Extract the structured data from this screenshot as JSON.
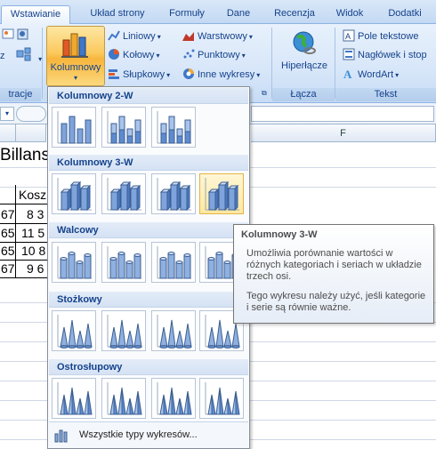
{
  "tabs": [
    {
      "label": "Wstawianie",
      "active": true
    },
    {
      "label": "Układ strony"
    },
    {
      "label": "Formuły"
    },
    {
      "label": "Dane"
    },
    {
      "label": "Recenzja"
    },
    {
      "label": "Widok"
    },
    {
      "label": "Dodatki"
    }
  ],
  "ribbon": {
    "left_group_label": "tracje",
    "left_small_label": "z",
    "columns_button": "Kolumnowy",
    "charts_small": {
      "liniowy": "Liniowy",
      "kolowy": "Kołowy",
      "slupkowy": "Słupkowy",
      "warstwowy": "Warstwowy",
      "punktowy": "Punktowy",
      "inne": "Inne wykresy"
    },
    "hyperlink": "Hiperłącze",
    "links_group": "Łącza",
    "text": {
      "pole": "Pole tekstowe",
      "naglowek": "Nagłówek i stop",
      "wordart": "WordArt"
    },
    "text_group": "Tekst"
  },
  "sheet": {
    "col_f": "F",
    "title_fragment": "Billans",
    "header_fragment": "Kosz",
    "rows": [
      {
        "a": "67",
        "b": "8 3"
      },
      {
        "a": "65",
        "b": "11 5"
      },
      {
        "a": "65",
        "b": "10 8"
      },
      {
        "a": "67",
        "b": "9 6"
      }
    ]
  },
  "gallery": {
    "sections": [
      "Kolumnowy 2-W",
      "Kolumnowy 3-W",
      "Walcowy",
      "Stożkowy",
      "Ostrosłupowy"
    ],
    "footer": "Wszystkie typy wykresów..."
  },
  "tooltip": {
    "title": "Kolumnowy 3-W",
    "p1": "Umożliwia porównanie wartości w różnych kategoriach i seriach w układzie trzech osi.",
    "p2": "Tego wykresu należy użyć, jeśli kategorie i serie są równie ważne."
  }
}
